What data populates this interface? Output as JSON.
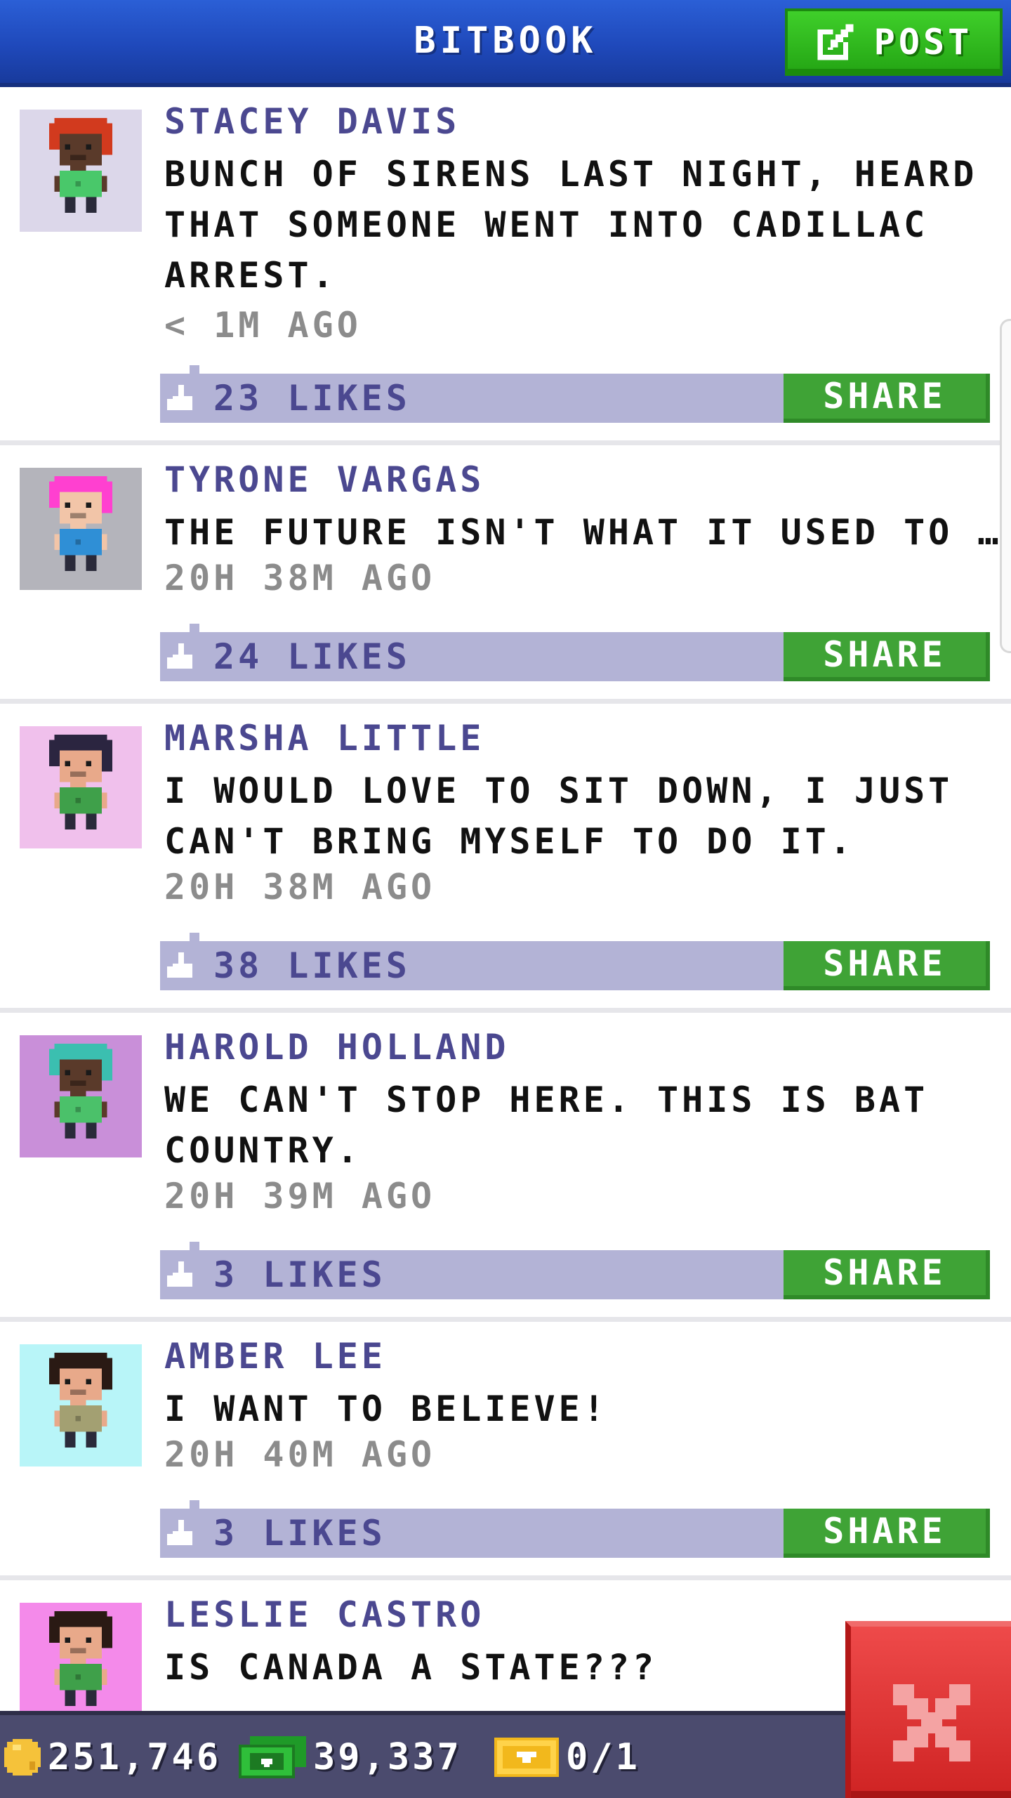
{
  "header": {
    "title": "BITBOOK",
    "post_label": "POST"
  },
  "feed": {
    "share_label": "SHARE",
    "posts": [
      {
        "name": "STACEY DAVIS",
        "message": "BUNCH OF SIRENS LAST NIGHT, HEARD\nTHAT SOMEONE WENT INTO CADILLAC\nARREST.",
        "time": "< 1M AGO",
        "likes": "23 LIKES",
        "avatar_bg": "#dcd7ea",
        "skin": "#5a3a2a",
        "hair": "#d23a1e",
        "shirt": "#49c86a"
      },
      {
        "name": "TYRONE VARGAS",
        "message": "THE FUTURE ISN'T WHAT IT USED TO BE...",
        "time": "20H 38M AGO",
        "likes": "24 LIKES",
        "avatar_bg": "#b4b4bb",
        "skin": "#f2c5a8",
        "hair": "#ff40d0",
        "shirt": "#2f8fd6"
      },
      {
        "name": "MARSHA LITTLE",
        "message": "I WOULD LOVE TO SIT DOWN, I JUST\nCAN'T BRING MYSELF TO DO IT.",
        "time": "20H 38M AGO",
        "likes": "38 LIKES",
        "avatar_bg": "#f0c0ec",
        "skin": "#e8a98a",
        "hair": "#2b2540",
        "shirt": "#3fa04a"
      },
      {
        "name": "HAROLD HOLLAND",
        "message": "WE CAN'T STOP HERE. THIS IS BAT\nCOUNTRY.",
        "time": "20H 39M AGO",
        "likes": "3 LIKES",
        "avatar_bg": "#c98fd9",
        "skin": "#5a3a2a",
        "hair": "#3bbfb0",
        "shirt": "#4bc16a"
      },
      {
        "name": "AMBER LEE",
        "message": "I WANT TO BELIEVE!",
        "time": "20H 40M AGO",
        "likes": "3 LIKES",
        "avatar_bg": "#b8f5f8",
        "skin": "#e8a98a",
        "hair": "#2a1a14",
        "shirt": "#a3a072"
      },
      {
        "name": "LESLIE CASTRO",
        "message": "IS CANADA A STATE???",
        "time": "",
        "likes": "",
        "avatar_bg": "#f48aea",
        "skin": "#e8a98a",
        "hair": "#2a1a14",
        "shirt": "#3fa04a"
      }
    ]
  },
  "status": {
    "coins": "251,746",
    "bux": "39,337",
    "tickets": "0/1"
  },
  "colors": {
    "header_blue": "#1f49bb",
    "post_green": "#24a514",
    "share_green": "#3fa336",
    "like_bar": "#b3b3d6",
    "name_purple": "#4b4890",
    "close_red": "#cf2323"
  },
  "icons": {
    "post": "pen-square-icon",
    "like": "thumbs-up-icon",
    "coin": "coin-icon",
    "bux": "bux-icon",
    "ticket": "ticket-icon",
    "close": "close-icon"
  }
}
